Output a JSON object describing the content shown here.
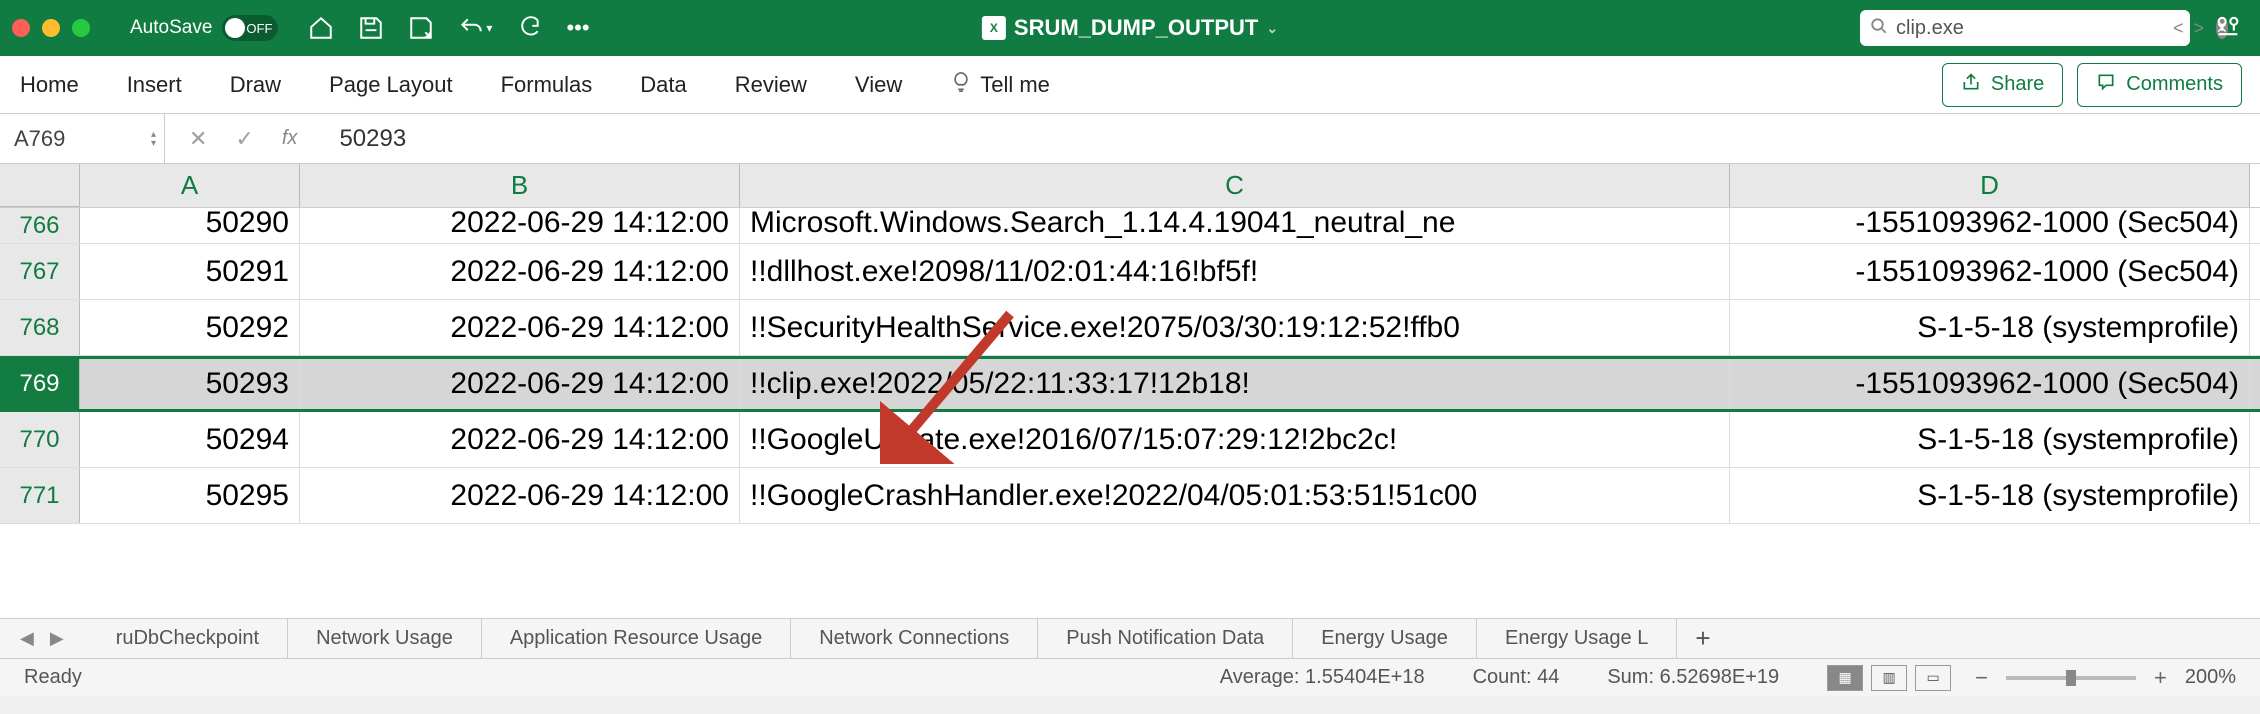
{
  "titlebar": {
    "autosave": "AutoSave",
    "autosave_state": "OFF",
    "filename": "SRUM_DUMP_OUTPUT"
  },
  "search": {
    "value": "clip.exe"
  },
  "ribbon": {
    "tabs": [
      "Home",
      "Insert",
      "Draw",
      "Page Layout",
      "Formulas",
      "Data",
      "Review",
      "View"
    ],
    "tellme": "Tell me",
    "share": "Share",
    "comments": "Comments"
  },
  "formula_bar": {
    "cell_ref": "A769",
    "fx": "fx",
    "value": "50293"
  },
  "columns": [
    "A",
    "B",
    "C",
    "D"
  ],
  "rows": [
    {
      "num": "766",
      "a": "50290",
      "b": "2022-06-29 14:12:00",
      "c": "Microsoft.Windows.Search_1.14.4.19041_neutral_ne",
      "d": "-1551093962-1000 (Sec504)",
      "partial": true
    },
    {
      "num": "767",
      "a": "50291",
      "b": "2022-06-29 14:12:00",
      "c": "!!dllhost.exe!2098/11/02:01:44:16!bf5f!",
      "d": "-1551093962-1000 (Sec504)"
    },
    {
      "num": "768",
      "a": "50292",
      "b": "2022-06-29 14:12:00",
      "c": "!!SecurityHealthService.exe!2075/03/30:19:12:52!ffb0",
      "d": "S-1-5-18 (systemprofile)"
    },
    {
      "num": "769",
      "a": "50293",
      "b": "2022-06-29 14:12:00",
      "c": "!!clip.exe!2022/05/22:11:33:17!12b18!",
      "d": "-1551093962-1000 (Sec504)",
      "selected": true
    },
    {
      "num": "770",
      "a": "50294",
      "b": "2022-06-29 14:12:00",
      "c": "!!GoogleUpdate.exe!2016/07/15:07:29:12!2bc2c!",
      "d": "S-1-5-18 (systemprofile)"
    },
    {
      "num": "771",
      "a": "50295",
      "b": "2022-06-29 14:12:00",
      "c": "!!GoogleCrashHandler.exe!2022/04/05:01:53:51!51c00",
      "d": "S-1-5-18 (systemprofile)"
    }
  ],
  "sheets": [
    "ruDbCheckpoint",
    "Network Usage",
    "Application Resource Usage",
    "Network Connections",
    "Push Notification Data",
    "Energy Usage",
    "Energy Usage L"
  ],
  "status": {
    "ready": "Ready",
    "average": "Average: 1.55404E+18",
    "count": "Count: 44",
    "sum": "Sum: 6.52698E+19",
    "zoom": "200%"
  }
}
